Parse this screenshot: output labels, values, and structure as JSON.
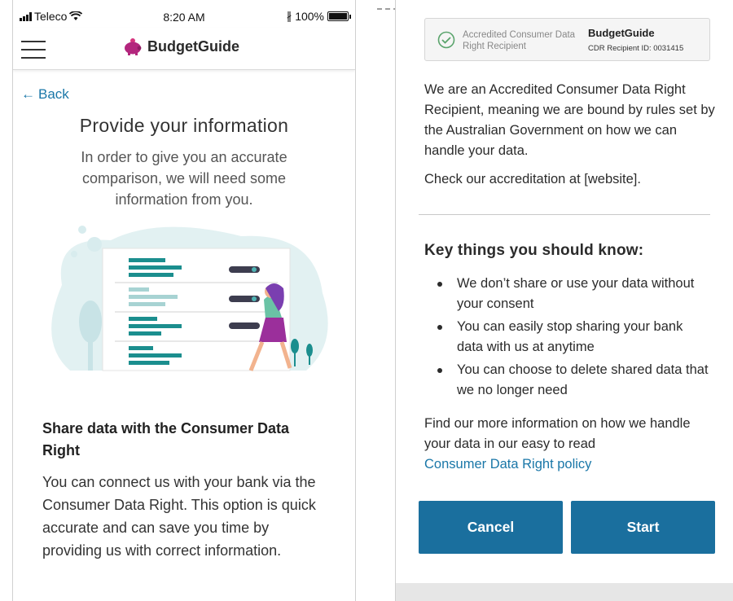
{
  "status_bar": {
    "carrier": "Teleco",
    "time": "8:20 AM",
    "battery_percent": "100%",
    "battery_level": 1.0,
    "icons": [
      "signal-icon",
      "wifi-icon",
      "bluetooth-icon",
      "battery-icon"
    ]
  },
  "header": {
    "brand": "BudgetGuide",
    "logo_icon": "piggy-bank-icon",
    "menu_icon": "hamburger-menu-icon"
  },
  "left": {
    "back_label": "Back",
    "title": "Provide your information",
    "intro": "In order to give you an accurate comparison, we will need some information from you.",
    "section_heading": "Share data with the Consumer Data Right",
    "section_body": "You can connect us with your bank via the Consumer Data Right. This option is quick accurate and can save you time by providing us with correct information."
  },
  "right": {
    "accreditation": {
      "label": "Accredited Consumer Data Right Recipient",
      "name": "BudgetGuide",
      "recipient_id": "CDR Recipient ID: 0031415"
    },
    "para1": "We are an Accredited Consumer Data Right Recipient, meaning we are bound by rules set by the Australian Government on how we can handle your data.",
    "para2": "Check our accreditation at [website].",
    "key_heading": "Key things you should know:",
    "key_points": [
      "We don’t share or use your data without your consent",
      "You can easily stop sharing your bank data with us at anytime",
      "You can choose to delete shared data that we no longer need"
    ],
    "para3": "Find our more information on how we handle your data in our easy to read",
    "policy_link": "Consumer Data Right policy",
    "cancel_label": "Cancel",
    "start_label": "Start"
  },
  "colors": {
    "primary": "#1a6f9e",
    "link": "#1a77a8",
    "brand_logo": "#b3267d",
    "illustration_teal": "#1b8e8e",
    "illustration_bg": "#e2f1f2"
  }
}
